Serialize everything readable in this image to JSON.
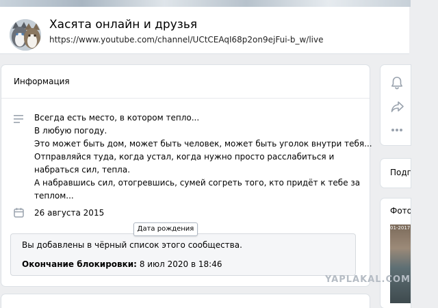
{
  "header": {
    "name": "Хасята онлайн и друзья",
    "status": "https://www.youtube.com/channel/UCtCEAqI68p2on9ejFui-b_w/live",
    "avatar_icon": "husky-dogs-avatar"
  },
  "info": {
    "title": "Информация",
    "description_icon": "lines-icon",
    "description_lines": [
      "Всегда есть место, в котором тепло...",
      "В любую погоду.",
      "Это может быть дом, может быть человек, может быть уголок внутри тебя...",
      "Отправляйся туда, когда устал, когда нужно просто расслабиться и",
      "набраться сил, тепла.",
      "А набравшись сил, отогревшись, сумей согреть того, кто придёт к тебе за",
      "теплом..."
    ],
    "date_icon": "calendar-icon",
    "founded": "26 августа 2015",
    "tooltip": "Дата рождения"
  },
  "ban": {
    "message": "Вы добавлены в чёрный список этого сообщества.",
    "end_label": "Окончание блокировки:",
    "end_value": "8 июл 2020 в 18:46"
  },
  "right_panel": {
    "icons": [
      "bell-icon",
      "share-icon",
      "more-icon"
    ],
    "subscribers_label": "Подп",
    "photos_label": "Фото",
    "photo_stamp": "01-2017"
  },
  "watermark": "YAPLAKAL.COM",
  "colors": {
    "background": "#edeef0",
    "card": "#ffffff",
    "icon": "#99a2ad",
    "ban_bg": "#f5f6f8"
  }
}
